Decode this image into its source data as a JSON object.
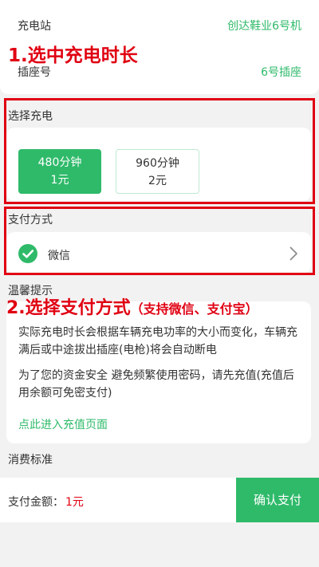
{
  "station": {
    "label": "充电站",
    "value": "创达鞋业6号机",
    "socket_label": "插座号",
    "socket_value": "6号插座"
  },
  "annotations": {
    "step1": "1.选中充电时长",
    "step2_main": "2.选择支付方式",
    "step2_sub": "（支持微信、支付宝）"
  },
  "charge": {
    "title": "选择充电",
    "options": [
      {
        "duration": "480分钟",
        "price": "1元",
        "selected": true
      },
      {
        "duration": "960分钟",
        "price": "2元",
        "selected": false
      }
    ]
  },
  "payment": {
    "title": "支付方式",
    "method": "微信",
    "icon": "wechat-icon"
  },
  "tips": {
    "title": "温馨提示",
    "line1": "实际充电时长会根据车辆充电功率的大小而变化，车辆充满后或中途拔出插座(电枪)将会自动断电",
    "line2": "为了您的资金安全 避免频繁使用密码，请先充值(充值后用余额可免密支付)",
    "recharge_link": "点此进入充值页面"
  },
  "consumption": {
    "title": "消费标准"
  },
  "footer": {
    "amount_label": "支付金额：",
    "amount_value": "1元",
    "pay_button": "确认支付"
  },
  "colors": {
    "accent": "#2fba6a",
    "annotation": "#e00012",
    "price": "#e00012"
  }
}
